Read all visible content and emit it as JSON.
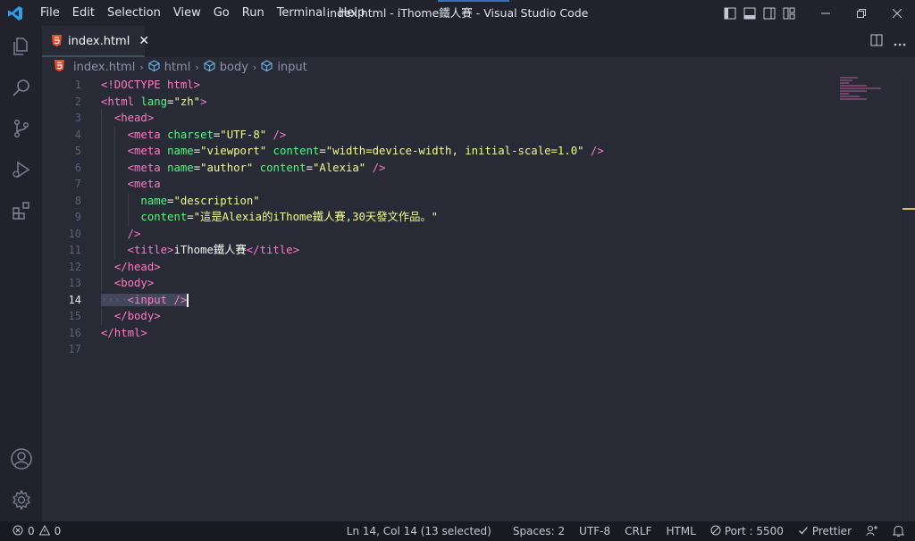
{
  "window": {
    "title": "index.html - iThome鐵人賽 - Visual Studio Code",
    "accent": "#3d6fb8"
  },
  "menu": [
    "File",
    "Edit",
    "Selection",
    "View",
    "Go",
    "Run",
    "Terminal",
    "Help"
  ],
  "activity_bar": {
    "top": [
      "explorer-icon",
      "search-icon",
      "source-control-icon",
      "run-debug-icon",
      "extensions-icon"
    ],
    "bottom": [
      "account-icon",
      "settings-gear-icon"
    ]
  },
  "tab": {
    "label": "index.html",
    "close": "✕",
    "icon": "html5-icon"
  },
  "breadcrumb": {
    "file": "index.html",
    "items": [
      "html",
      "body",
      "input"
    ],
    "separator": "›"
  },
  "editor": {
    "active_line": 14,
    "line_numbers": [
      "1",
      "2",
      "3",
      "4",
      "5",
      "6",
      "7",
      "8",
      "9",
      "10",
      "11",
      "12",
      "13",
      "14",
      "15",
      "16",
      "17"
    ],
    "code": {
      "l1": {
        "open": "<!DOCTYPE html>"
      },
      "l2": {
        "tag_open": "<html",
        "attr": "lang",
        "eq": "=",
        "val": "\"zh\"",
        "close": ">"
      },
      "l3": {
        "tag": "<head>"
      },
      "l4": {
        "tag_open": "<meta",
        "attr": "charset",
        "eq": "=",
        "val": "\"UTF-8\"",
        "close": " />"
      },
      "l5": {
        "tag_open": "<meta",
        "attr1": "name",
        "eq": "=",
        "val1": "\"viewport\"",
        "attr2": "content",
        "val2": "\"width=device-width, initial-scale=1.0\"",
        "close": " />"
      },
      "l6": {
        "tag_open": "<meta",
        "attr1": "name",
        "eq": "=",
        "val1": "\"author\"",
        "attr2": "content",
        "val2": "\"Alexia\"",
        "close": " />"
      },
      "l7": {
        "tag": "<meta"
      },
      "l8": {
        "attr": "name",
        "eq": "=",
        "val": "\"description\""
      },
      "l9": {
        "attr": "content",
        "eq": "=",
        "val": "\"這是Alexia的iThome鐵人賽,30天發文作品。\""
      },
      "l10": {
        "close": "/>"
      },
      "l11": {
        "open": "<title>",
        "text": "iThome鐵人賽",
        "close": "</title>"
      },
      "l12": {
        "tag": "</head>"
      },
      "l13": {
        "tag": "<body>"
      },
      "l14": {
        "ws": "····",
        "tag": "<input />"
      },
      "l15": {
        "tag": "</body>"
      },
      "l16": {
        "tag": "</html>"
      }
    }
  },
  "status_bar": {
    "errors": "0",
    "warnings": "0",
    "position": "Ln 14, Col 14 (13 selected)",
    "spaces": "Spaces: 2",
    "encoding": "UTF-8",
    "eol": "CRLF",
    "language": "HTML",
    "port": "Port : 5500",
    "prettier": "Prettier"
  }
}
